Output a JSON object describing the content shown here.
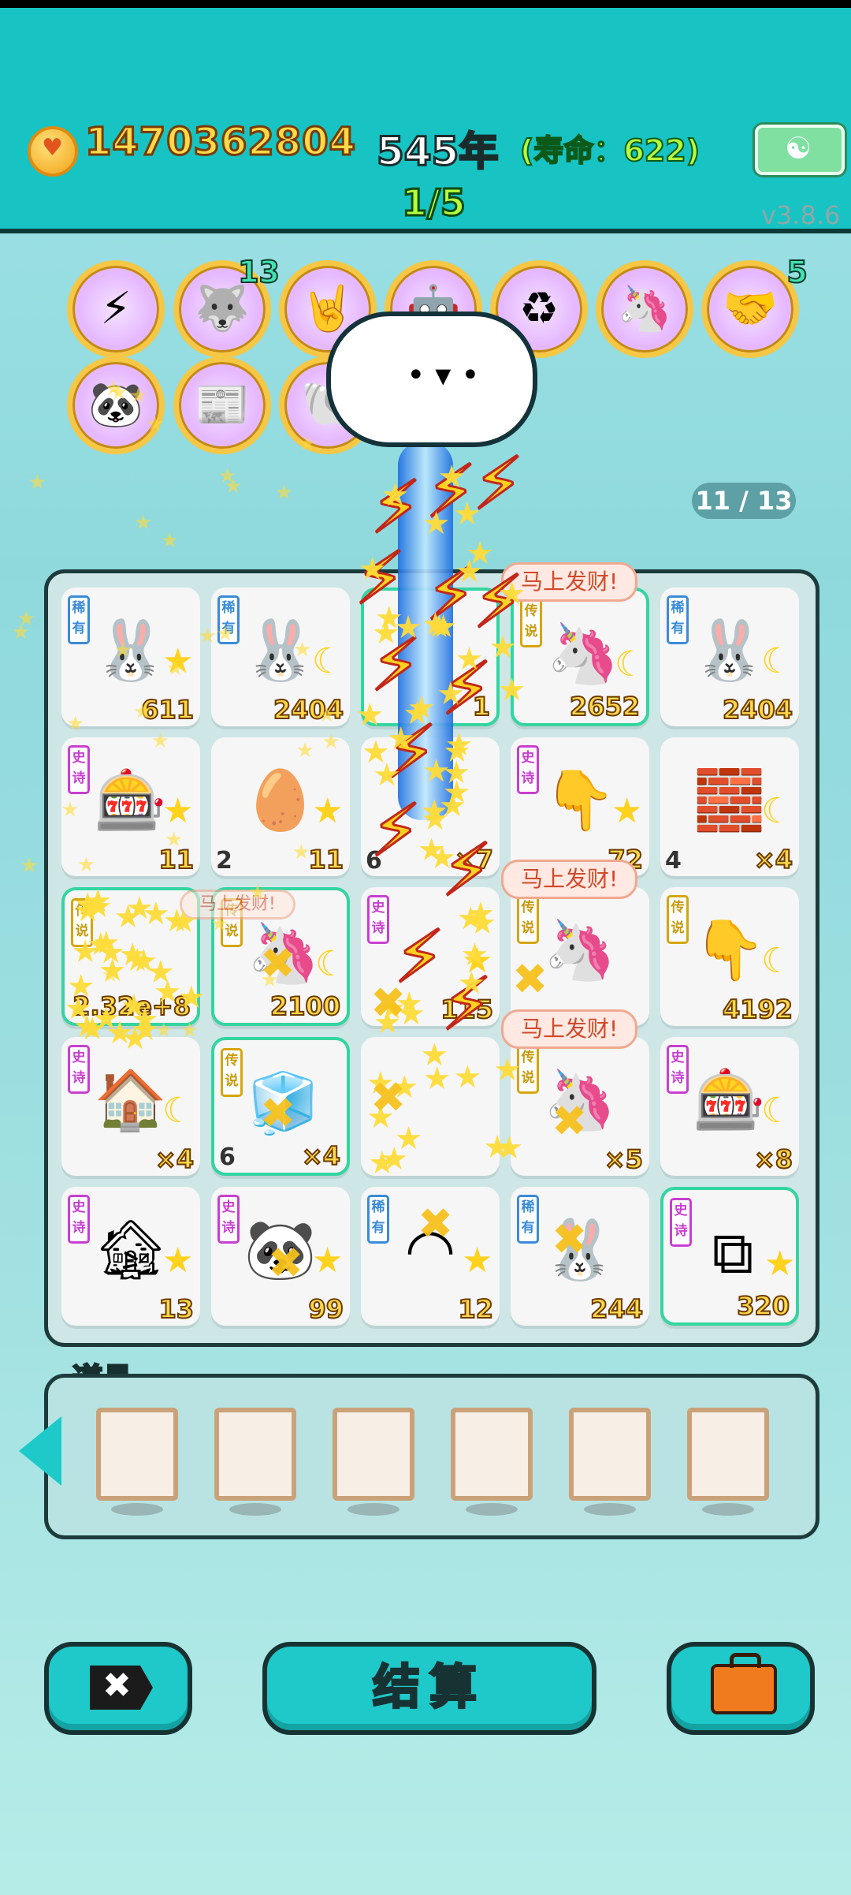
{
  "header": {
    "coins": "1470362804",
    "year": "545年",
    "lifespan": "(寿命：622)",
    "round": "1/5",
    "version": "v3.8.6",
    "meditate_icon": "meditation-icon"
  },
  "relics": [
    {
      "icon": "lightning-icon",
      "glyph": "⚡",
      "count": ""
    },
    {
      "icon": "husky-dog-icon",
      "glyph": "🐺",
      "count": "13"
    },
    {
      "icon": "rock-hand-icon",
      "glyph": "🤘",
      "count": ""
    },
    {
      "icon": "robot-icon",
      "glyph": "🤖",
      "count": ""
    },
    {
      "icon": "recycle-icon",
      "glyph": "♻",
      "count": ""
    },
    {
      "icon": "unicorn-icon",
      "glyph": "🦄",
      "count": ""
    },
    {
      "icon": "handshake-icon",
      "glyph": "🤝",
      "count": "5"
    },
    {
      "icon": "panda-icon",
      "glyph": "🐼",
      "count": ""
    },
    {
      "icon": "time-magazine-icon",
      "glyph": "📰",
      "count": ""
    },
    {
      "icon": "shell-icon",
      "glyph": "🐚",
      "count": ""
    }
  ],
  "relic_counter": "11 / 13",
  "board": {
    "bubble_text": "马上发财!",
    "cells": [
      {
        "tag": "稀有",
        "tagc": "blue",
        "icon": "rabbit-icon",
        "glyph": "🐰",
        "star": "★",
        "val": "611",
        "lnum": ""
      },
      {
        "tag": "稀有",
        "tagc": "blue",
        "icon": "rabbit-icon",
        "glyph": "🐰",
        "star": "☾",
        "val": "2404",
        "lnum": ""
      },
      {
        "tag": "",
        "tagc": "gold",
        "icon": "lightning-icon",
        "glyph": "",
        "star": "",
        "val": "1",
        "lnum": ""
      },
      {
        "tag": "传说",
        "tagc": "gold",
        "icon": "unicorn-icon",
        "glyph": "🦄",
        "star": "☾",
        "val": "2652",
        "lnum": ""
      },
      {
        "tag": "稀有",
        "tagc": "blue",
        "icon": "rabbit-icon",
        "glyph": "🐰",
        "star": "☾",
        "val": "2404",
        "lnum": ""
      },
      {
        "tag": "史诗",
        "tagc": "purple",
        "icon": "claw-machine-icon",
        "glyph": "🎰",
        "star": "★",
        "val": "11",
        "lnum": ""
      },
      {
        "tag": "",
        "tagc": "blue",
        "icon": "egg-icon",
        "glyph": "🥚",
        "star": "★",
        "val": "11",
        "lnum": "2"
      },
      {
        "tag": "",
        "tagc": "gold",
        "icon": "fridge-icon",
        "glyph": "",
        "star": "",
        "val": "×7",
        "lnum": "6"
      },
      {
        "tag": "史诗",
        "tagc": "purple",
        "icon": "pointing-hand-icon",
        "glyph": "👇",
        "star": "★",
        "val": "72",
        "lnum": ""
      },
      {
        "tag": "",
        "tagc": "blue",
        "icon": "gold-bars-icon",
        "glyph": "🧱",
        "star": "☾",
        "val": "×4",
        "lnum": "4"
      },
      {
        "tag": "传说",
        "tagc": "gold",
        "icon": "star-burst-icon",
        "glyph": "",
        "star": "",
        "val": "2.32e+8",
        "lnum": ""
      },
      {
        "tag": "传说",
        "tagc": "gold",
        "icon": "unicorn-icon",
        "glyph": "🦄",
        "star": "☾",
        "val": "2100",
        "lnum": ""
      },
      {
        "tag": "史诗",
        "tagc": "purple",
        "icon": "book-icon",
        "glyph": "",
        "star": "★",
        "val": "115",
        "lnum": ""
      },
      {
        "tag": "传说",
        "tagc": "gold",
        "icon": "unicorn-icon",
        "glyph": "🦄",
        "star": "",
        "val": "",
        "lnum": ""
      },
      {
        "tag": "传说",
        "tagc": "gold",
        "icon": "pointing-hand-yellow-icon",
        "glyph": "👇",
        "star": "☾",
        "val": "4192",
        "lnum": ""
      },
      {
        "tag": "史诗",
        "tagc": "purple",
        "icon": "pet-house-icon",
        "glyph": "🏠",
        "star": "☾",
        "val": "×4",
        "lnum": ""
      },
      {
        "tag": "传说",
        "tagc": "gold",
        "icon": "fridge-icon",
        "glyph": "🧊",
        "star": "",
        "val": "×4",
        "lnum": "6"
      },
      {
        "tag": "",
        "tagc": "gold",
        "icon": "star-pile-icon",
        "glyph": "",
        "star": "",
        "val": "",
        "lnum": ""
      },
      {
        "tag": "传说",
        "tagc": "gold",
        "icon": "unicorn-icon",
        "glyph": "🦄",
        "star": "",
        "val": "×5",
        "lnum": ""
      },
      {
        "tag": "史诗",
        "tagc": "purple",
        "icon": "claw-machine-icon",
        "glyph": "🎰",
        "star": "☾",
        "val": "×8",
        "lnum": ""
      },
      {
        "tag": "史诗",
        "tagc": "purple",
        "icon": "haunted-house-icon",
        "glyph": "🏚",
        "star": "★",
        "val": "13",
        "lnum": ""
      },
      {
        "tag": "史诗",
        "tagc": "purple",
        "icon": "panda-icon",
        "glyph": "🐼",
        "star": "★",
        "val": "99",
        "lnum": ""
      },
      {
        "tag": "稀有",
        "tagc": "blue",
        "icon": "gauge-icon",
        "glyph": "◠",
        "star": "★",
        "val": "12",
        "lnum": ""
      },
      {
        "tag": "稀有",
        "tagc": "blue",
        "icon": "rabbit-icon",
        "glyph": "🐰",
        "star": "",
        "val": "244",
        "lnum": ""
      },
      {
        "tag": "史诗",
        "tagc": "purple",
        "icon": "ctrl-cv-cards-icon",
        "glyph": "⧉",
        "star": "★",
        "val": "320",
        "lnum": ""
      }
    ]
  },
  "tools": {
    "label": "道具",
    "slot_count": 6,
    "back_icon": "left-arrow-icon"
  },
  "buttons": {
    "cancel_icon": "close-x-icon",
    "settle_label": "结算",
    "bag_icon": "briefcase-icon"
  },
  "colors": {
    "teal": "#17c3c3",
    "gold": "#ffd84a",
    "green_text": "#b6ff3b"
  }
}
